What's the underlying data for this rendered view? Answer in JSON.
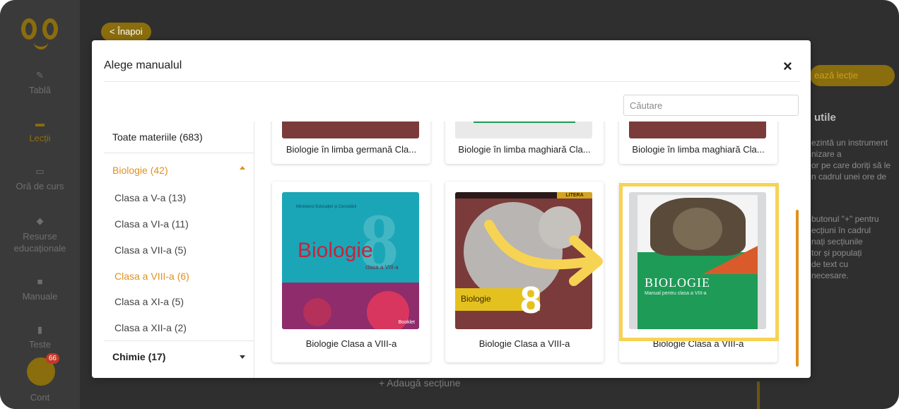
{
  "sidebar": {
    "items": [
      {
        "label": "Tablă",
        "icon": "pencil-icon"
      },
      {
        "label": "Lecții",
        "icon": "folder-icon"
      },
      {
        "label": "Oră de curs",
        "icon": "presentation-icon"
      },
      {
        "label": "Resurse educaționale",
        "icon": "cube-icon"
      },
      {
        "label": "Manuale",
        "icon": "book-icon"
      },
      {
        "label": "Teste",
        "icon": "document-icon"
      },
      {
        "label": "Cont",
        "icon": "avatar-icon"
      }
    ],
    "account_badge": "66"
  },
  "header": {
    "back_label": "< Înapoi"
  },
  "right_panel": {
    "save_label": "ează lecție",
    "useful_title": "utile",
    "useful_text_1": "ezintă un instrument\nnizare a\nor pe care doriți să le\nn cadrul unei ore de",
    "useful_text_2": "butonul \"+\" pentru\necțiuni în cadrul\nnați secțiunile\ntor și populați\nde text cu\nnecesare."
  },
  "add_section_label": "+ Adaugă secțiune",
  "modal": {
    "title": "Alege manualul",
    "close_symbol": "×",
    "search_placeholder": "Căutare",
    "categories": {
      "all": "Toate materiile (683)",
      "biology": "Biologie (42)",
      "grades": [
        "Clasa a V-a (13)",
        "Clasa a VI-a (11)",
        "Clasa a VII-a (5)",
        "Clasa a VIII-a (6)",
        "Clasa a XI-a (5)",
        "Clasa a XII-a (2)"
      ],
      "active_grade": "Clasa a VIII-a (6)",
      "chemistry": "Chimie (17)"
    },
    "books": [
      {
        "title": "Biologie în limba germană Cla..."
      },
      {
        "title": "Biologie în limba maghiară Cla..."
      },
      {
        "title": "Biologie în limba maghiară Cla..."
      },
      {
        "title": "Biologie Clasa a VIII-a",
        "cover_word": "Biologie",
        "cover_num": "8",
        "cover_sub": "clasa a VIII-a",
        "cover_top": "Ministerul Educației și Cercetării",
        "cover_publisher": "Booklet"
      },
      {
        "title": "Biologie Clasa a VIII-a",
        "cover_word": "Biologie",
        "cover_num": "8",
        "cover_publisher": "LITERA"
      },
      {
        "title": "Biologie Clasa a VIII-a",
        "cover_word": "BIOLOGIE",
        "cover_sub": "Manual pentru clasa a VIII-a"
      }
    ]
  },
  "colors": {
    "accent": "#e0901f",
    "highlight": "#f7d354",
    "arrow": "#f7d354"
  }
}
